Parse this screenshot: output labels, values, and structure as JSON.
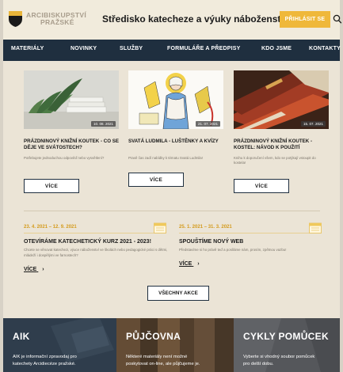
{
  "header": {
    "logo_line1": "ARCIBISKUPSTVÍ",
    "logo_line2": "PRAŽSKÉ",
    "site_title": "Středisko katecheze a výuky náboženství",
    "login_label": "PŘIHLÁSIT SE"
  },
  "nav": {
    "items": [
      "MATERIÁLY",
      "NOVINKY",
      "SLUŽBY",
      "FORMULÁŘE A PŘEDPISY",
      "KDO JSME",
      "KONTAKTY"
    ]
  },
  "cards": [
    {
      "title": "PRÁZDNINOVÝ KNIŽNÍ KOUTEK - CO SE DĚJE VE SVÁTOSTECH?",
      "desc": "Potřebujete jednoduchou odpověď nebo vysvětlení?",
      "date": "10. 08. 2021",
      "more_label": "VÍCE"
    },
    {
      "title": "SVATÁ LUDMILA - LUŠTĚNKY A KVÍZY",
      "desc": "Pravě čas zadí nabídky k tématu Svatá Ludmila!",
      "date": "21. 07. 2021",
      "more_label": "VÍCE"
    },
    {
      "title": "PRÁZDNINOVÝ KNIŽNÍ KOUTEK - KOSTEL: NÁVOD K POUŽITÍ",
      "desc": "Knihu k doporučení všem, kdo se potýkají vstoupit do kostela!",
      "date": "15. 07. 2021",
      "more_label": "VÍCE"
    }
  ],
  "events": [
    {
      "date": "23. 4. 2021 – 12. 9. 2021",
      "title": "OTEVÍRÁME KATECHETICKÝ KURZ 2021 - 2023!",
      "desc": "Chcete se věnovat katechezi, výuce náboženství ve školách nebo pedagogické práci s dětmi, mládeží i dospělými ve farnostech?",
      "more_label": "VÍCE"
    },
    {
      "date": "25. 1. 2021 – 31. 3. 2021",
      "title": "SPOUŠTÍME NOVÝ WEB",
      "desc": "Představíme si ho právě teď a posíláme nám, prosím, zpětnou vazbu!",
      "more_label": "VÍCE"
    }
  ],
  "all_events_label": "VŠECHNY AKCE",
  "panels": [
    {
      "title": "AIK",
      "text": [
        "AIK je informační zpravodaj pro",
        "katechety Arcidiecéze pražské."
      ],
      "bg": "#2c3b4b"
    },
    {
      "title": "PŮJČOVNA",
      "text": [
        "Některé materiály není možné",
        "poskytovat on-line, ale půjčujeme je."
      ],
      "bg": "#6c5740"
    },
    {
      "title": "CYKLY POMŮCEK",
      "text": [
        "Vyberte si vhodný soubor pomůcek",
        "pro delší dobu."
      ],
      "bg": "#54565a"
    }
  ],
  "colors": {
    "accent": "#efb83a",
    "nav_bg": "#1f2f3f",
    "page_bg": "#ebe4d6",
    "date_accent": "#d49b1d"
  }
}
